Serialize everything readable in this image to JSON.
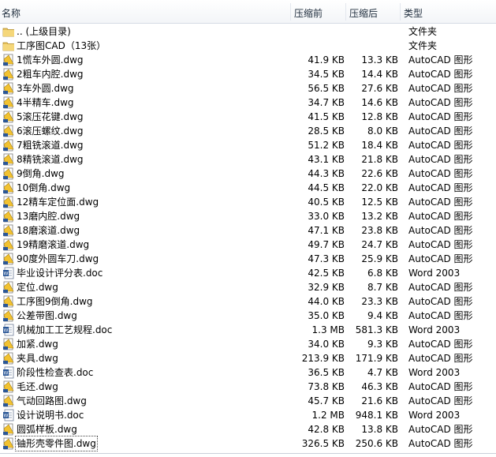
{
  "columns": {
    "name": "名称",
    "before": "压缩前",
    "after": "压缩后",
    "type": "类型"
  },
  "rows": [
    {
      "name": ".. (上级目录)",
      "before": "",
      "after": "",
      "type": "文件夹",
      "icon": "folder-up-icon"
    },
    {
      "name": "工序图CAD（13张）",
      "before": "",
      "after": "",
      "type": "文件夹",
      "icon": "folder-icon"
    },
    {
      "name": "1慌车外圆.dwg",
      "before": "41.9 KB",
      "after": "13.3 KB",
      "type": "AutoCAD 图形",
      "icon": "dwg-file-icon"
    },
    {
      "name": "2粗车内腔.dwg",
      "before": "34.5 KB",
      "after": "14.4 KB",
      "type": "AutoCAD 图形",
      "icon": "dwg-file-icon"
    },
    {
      "name": "3车外圆.dwg",
      "before": "56.5 KB",
      "after": "27.6 KB",
      "type": "AutoCAD 图形",
      "icon": "dwg-file-icon"
    },
    {
      "name": "4半精车.dwg",
      "before": "34.7 KB",
      "after": "14.6 KB",
      "type": "AutoCAD 图形",
      "icon": "dwg-file-icon"
    },
    {
      "name": "5滚压花键.dwg",
      "before": "41.5 KB",
      "after": "12.8 KB",
      "type": "AutoCAD 图形",
      "icon": "dwg-file-icon"
    },
    {
      "name": "6滚压螺纹.dwg",
      "before": "28.5 KB",
      "after": "8.0 KB",
      "type": "AutoCAD 图形",
      "icon": "dwg-file-icon"
    },
    {
      "name": "7粗铣滚道.dwg",
      "before": "51.2 KB",
      "after": "18.4 KB",
      "type": "AutoCAD 图形",
      "icon": "dwg-file-icon"
    },
    {
      "name": "8精铣滚道.dwg",
      "before": "43.1 KB",
      "after": "21.8 KB",
      "type": "AutoCAD 图形",
      "icon": "dwg-file-icon"
    },
    {
      "name": "9倒角.dwg",
      "before": "44.3 KB",
      "after": "22.6 KB",
      "type": "AutoCAD 图形",
      "icon": "dwg-file-icon"
    },
    {
      "name": "10倒角.dwg",
      "before": "44.5 KB",
      "after": "22.0 KB",
      "type": "AutoCAD 图形",
      "icon": "dwg-file-icon"
    },
    {
      "name": "12精车定位面.dwg",
      "before": "40.5 KB",
      "after": "12.5 KB",
      "type": "AutoCAD 图形",
      "icon": "dwg-file-icon"
    },
    {
      "name": "13磨内腔.dwg",
      "before": "33.0 KB",
      "after": "13.2 KB",
      "type": "AutoCAD 图形",
      "icon": "dwg-file-icon"
    },
    {
      "name": "18磨滚道.dwg",
      "before": "47.1 KB",
      "after": "23.8 KB",
      "type": "AutoCAD 图形",
      "icon": "dwg-file-icon"
    },
    {
      "name": "19精磨滚道.dwg",
      "before": "49.7 KB",
      "after": "24.7 KB",
      "type": "AutoCAD 图形",
      "icon": "dwg-file-icon"
    },
    {
      "name": "90度外圆车刀.dwg",
      "before": "47.3 KB",
      "after": "25.9 KB",
      "type": "AutoCAD 图形",
      "icon": "dwg-file-icon"
    },
    {
      "name": "毕业设计评分表.doc",
      "before": "42.5 KB",
      "after": "6.8 KB",
      "type": "Word 2003",
      "icon": "doc-file-icon"
    },
    {
      "name": "定位.dwg",
      "before": "32.9 KB",
      "after": "8.7 KB",
      "type": "AutoCAD 图形",
      "icon": "dwg-file-icon"
    },
    {
      "name": "工序图9倒角.dwg",
      "before": "44.0 KB",
      "after": "23.3 KB",
      "type": "AutoCAD 图形",
      "icon": "dwg-file-icon"
    },
    {
      "name": "公差带图.dwg",
      "before": "35.0 KB",
      "after": "9.4 KB",
      "type": "AutoCAD 图形",
      "icon": "dwg-file-icon"
    },
    {
      "name": "机械加工工艺规程.doc",
      "before": "1.3 MB",
      "after": "581.3 KB",
      "type": "Word 2003",
      "icon": "doc-file-icon"
    },
    {
      "name": "加紧.dwg",
      "before": "34.0 KB",
      "after": "9.3 KB",
      "type": "AutoCAD 图形",
      "icon": "dwg-file-icon"
    },
    {
      "name": "夹具.dwg",
      "before": "213.9 KB",
      "after": "171.9 KB",
      "type": "AutoCAD 图形",
      "icon": "dwg-file-icon"
    },
    {
      "name": "阶段性检查表.doc",
      "before": "36.5 KB",
      "after": "4.7 KB",
      "type": "Word 2003",
      "icon": "doc-file-icon"
    },
    {
      "name": "毛还.dwg",
      "before": "73.8 KB",
      "after": "46.3 KB",
      "type": "AutoCAD 图形",
      "icon": "dwg-file-icon"
    },
    {
      "name": "气动回路图.dwg",
      "before": "45.7 KB",
      "after": "21.6 KB",
      "type": "AutoCAD 图形",
      "icon": "dwg-file-icon"
    },
    {
      "name": "设计说明书.doc",
      "before": "1.2 MB",
      "after": "948.1 KB",
      "type": "Word 2003",
      "icon": "doc-file-icon"
    },
    {
      "name": "圆弧样板.dwg",
      "before": "42.8 KB",
      "after": "13.8 KB",
      "type": "AutoCAD 图形",
      "icon": "dwg-file-icon"
    },
    {
      "name": "铀形壳零件图.dwg",
      "before": "326.5 KB",
      "after": "250.6 KB",
      "type": "AutoCAD 图形",
      "icon": "dwg-file-icon",
      "selected": true
    }
  ],
  "colors": {
    "header_text": "#1e2c3c",
    "folder_yellow": "#e8c25a",
    "dwg_yellow": "#f2c230",
    "doc_blue": "#2b5797"
  }
}
